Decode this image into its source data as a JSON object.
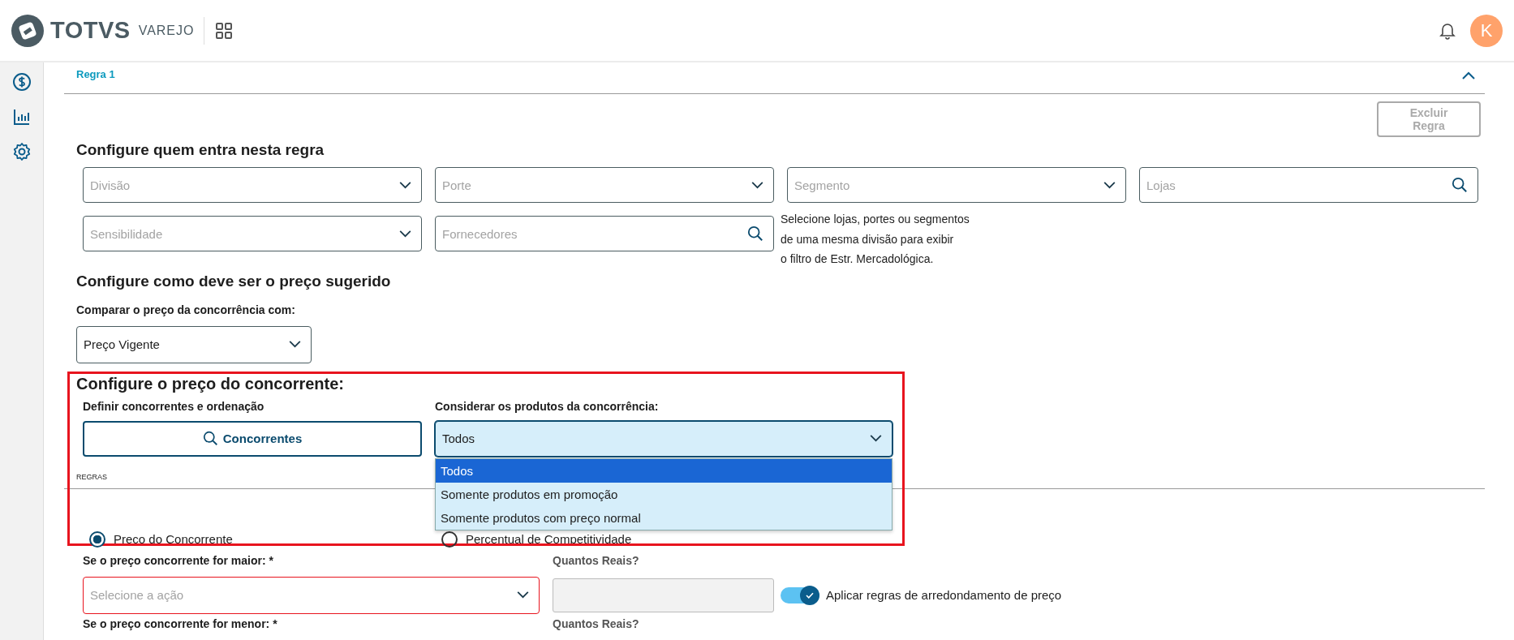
{
  "header": {
    "brand": "TOTVS",
    "product": "VAREJO",
    "avatar_initial": "K"
  },
  "section": {
    "title": "Regra 1",
    "expanded": true
  },
  "delete_button": {
    "label": "Excluir Regra",
    "disabled": true
  },
  "audience": {
    "title": "Configure quem entra nesta regra",
    "fields": [
      {
        "kind": "select",
        "placeholder": "Divisão"
      },
      {
        "kind": "select",
        "placeholder": "Porte"
      },
      {
        "kind": "select",
        "placeholder": "Segmento"
      },
      {
        "kind": "search",
        "placeholder": "Lojas"
      },
      {
        "kind": "select",
        "placeholder": "Sensibilidade"
      },
      {
        "kind": "search",
        "placeholder": "Fornecedores"
      }
    ],
    "hint_lines": [
      "Selecione lojas, portes ou segmentos",
      "de uma mesma divisão para exibir",
      "o filtro de Estr. Mercadológica."
    ]
  },
  "suggested": {
    "title": "Configure como deve ser o preço sugerido",
    "compare_label": "Comparar o preço da concorrência com:",
    "compare_value": "Preço Vigente"
  },
  "competitor": {
    "title": "Configure o preço do concorrente:",
    "highlighted": true,
    "define_label": "Definir concorrentes e ordenação",
    "button_label": "Concorrentes",
    "products_label": "Considerar os produtos da concorrência:",
    "products_value": "Todos",
    "dropdown": {
      "expanded": true,
      "options": [
        {
          "label": "Todos",
          "selected": true
        },
        {
          "label": "Somente produtos em promoção",
          "selected": false
        },
        {
          "label": "Somente produtos com preço normal",
          "selected": false
        }
      ]
    }
  },
  "rules": {
    "label": "REGRAS",
    "options": [
      {
        "label": "Preço do Concorrente",
        "selected": true
      },
      {
        "label": "Percentual de Competitividade",
        "selected": false
      }
    ]
  },
  "conditions": [
    {
      "label": "Se o preço concorrente for maior: *",
      "placeholder": "Selecione a ação",
      "invalid": true,
      "amount_label": "Quantos Reais?",
      "rounding": {
        "label": "Aplicar regras de arredondamento de preço",
        "on": true
      }
    },
    {
      "label": "Se o preço concorrente for menor: *",
      "amount_label": "Quantos Reais?"
    }
  ]
}
